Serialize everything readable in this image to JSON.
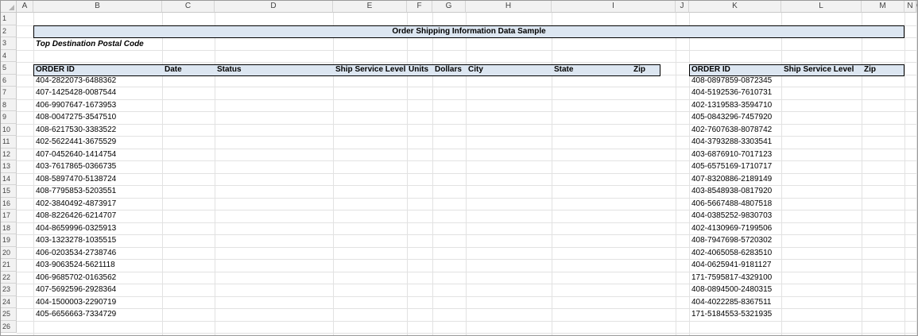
{
  "columns": [
    "A",
    "B",
    "C",
    "D",
    "E",
    "F",
    "G",
    "H",
    "I",
    "J",
    "K",
    "L",
    "M",
    "N",
    "O"
  ],
  "rows": [
    "1",
    "2",
    "3",
    "4",
    "5",
    "6",
    "7",
    "8",
    "9",
    "10",
    "11",
    "12",
    "13",
    "14",
    "15",
    "16",
    "17",
    "18",
    "19",
    "20",
    "21",
    "22",
    "23",
    "24",
    "25",
    "26"
  ],
  "sheet": {
    "title": "Order Shipping Information Data Sample",
    "subtitle": "Top Destination Postal Code",
    "left_table": {
      "headers": {
        "order_id": "ORDER ID",
        "date": "Date",
        "status": "Status",
        "ship_service_level": "Ship Service Level",
        "units": "Units",
        "dollars": "Dollars",
        "city": "City",
        "state": "State",
        "zip": "Zip"
      },
      "order_ids": [
        "404-2822073-6488362",
        "407-1425428-0087544",
        "406-9907647-1673953",
        "408-0047275-3547510",
        "408-6217530-3383522",
        "402-5622441-3675529",
        "407-0452640-1414754",
        "403-7617865-0366735",
        "408-5897470-5138724",
        "408-7795853-5203551",
        "402-3840492-4873917",
        "408-8226426-6214707",
        "404-8659996-0325913",
        "403-1323278-1035515",
        "406-0203534-2738746",
        "403-9063524-5621118",
        "406-9685702-0163562",
        "407-5692596-2928364",
        "404-1500003-2290719",
        "405-6656663-7334729"
      ]
    },
    "right_table": {
      "headers": {
        "order_id": "ORDER ID",
        "ship_service_level": "Ship Service Level",
        "zip": "Zip"
      },
      "order_ids": [
        "408-0897859-0872345",
        "404-5192536-7610731",
        "402-1319583-3594710",
        "405-0843296-7457920",
        "402-7607638-8078742",
        "404-3793288-3303541",
        "403-6876910-7017123",
        "405-6575169-1710717",
        "407-8320886-2189149",
        "403-8548938-0817920",
        "406-5667488-4807518",
        "404-0385252-9830703",
        "402-4130969-7199506",
        "408-7947698-5720302",
        "402-4065058-6283510",
        "404-0625941-9181127",
        "171-7595817-4329100",
        "408-0894500-2480315",
        "404-4022285-8367511",
        "171-5184553-5321935"
      ]
    }
  },
  "colors": {
    "header_band": "#dce6f1",
    "grid": "#e2e2e2",
    "heading_bg": "#f2f2f2"
  }
}
